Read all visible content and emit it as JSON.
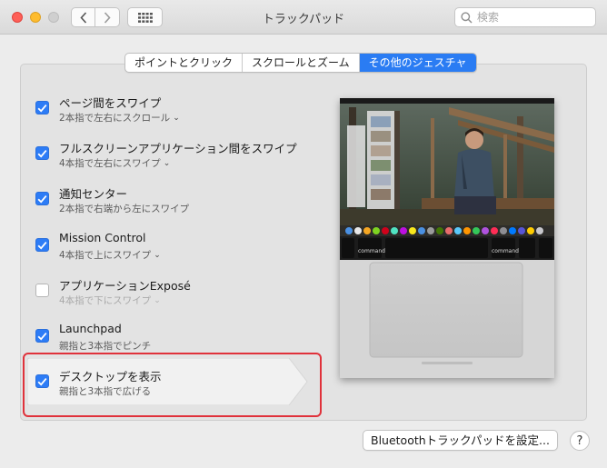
{
  "window": {
    "title": "トラックパッド",
    "search_placeholder": "検索"
  },
  "tabs": [
    {
      "label": "ポイントとクリック",
      "active": false
    },
    {
      "label": "スクロールとズーム",
      "active": false
    },
    {
      "label": "その他のジェスチャ",
      "active": true
    }
  ],
  "gestures": [
    {
      "label": "ページ間をスワイプ",
      "detail": "2本指で左右にスクロール",
      "checked": true,
      "has_menu": true
    },
    {
      "label": "フルスクリーンアプリケーション間をスワイプ",
      "detail": "4本指で左右にスワイプ",
      "checked": true,
      "has_menu": true
    },
    {
      "label": "通知センター",
      "detail": "2本指で右端から左にスワイプ",
      "checked": true,
      "has_menu": false
    },
    {
      "label": "Mission Control",
      "detail": "4本指で上にスワイプ",
      "checked": true,
      "has_menu": true
    },
    {
      "label": "アプリケーションExposé",
      "detail": "4本指で下にスワイプ",
      "checked": false,
      "has_menu": true
    },
    {
      "label": "Launchpad",
      "detail": "親指と3本指でピンチ",
      "checked": true,
      "has_menu": false
    },
    {
      "label": "デスクトップを表示",
      "detail": "親指と3本指で広げる",
      "checked": true,
      "has_menu": false
    }
  ],
  "preview": {
    "key_left": "command",
    "key_right": "command"
  },
  "buttons": {
    "bluetooth": "Bluetoothトラックパッドを設定...",
    "help": "?"
  },
  "colors": {
    "accent": "#2a7cf3",
    "highlight": "#e0323b"
  }
}
